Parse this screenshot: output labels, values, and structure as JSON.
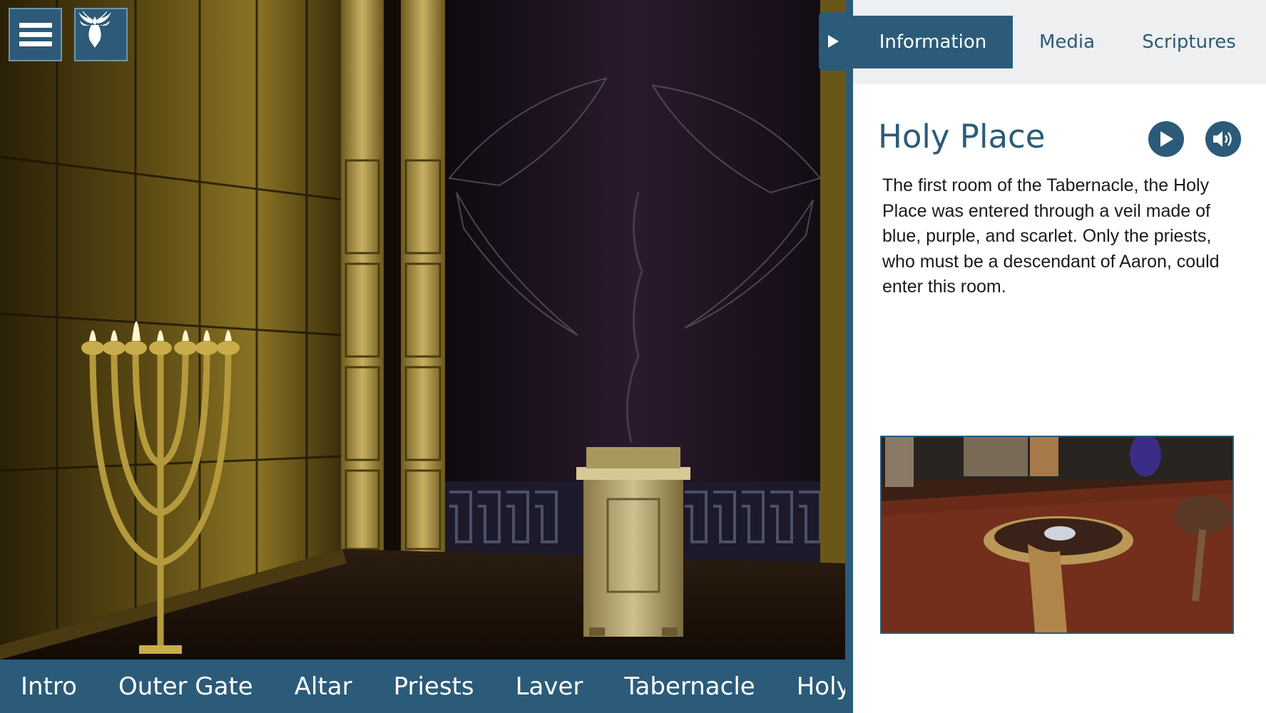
{
  "hud": {
    "menu_icon": "hamburger-menu-icon",
    "logo_icon": "eagle-logo-icon"
  },
  "panel_toggle_icon": "play-triangle-icon",
  "bottom_nav": {
    "items": [
      "Intro",
      "Outer Gate",
      "Altar",
      "Priests",
      "Laver",
      "Tabernacle",
      "Holy"
    ]
  },
  "tabs": {
    "information": "Information",
    "media": "Media",
    "scriptures": "Scriptures"
  },
  "info": {
    "title": "Holy Place",
    "description": "The first room of the Tabernacle, the Holy Place was entered through a veil made of blue, purple, and scarlet. Only the priests, who must be a descendant of Aaron, could enter this room.",
    "play_icon": "play-icon",
    "audio_icon": "speaker-icon",
    "thumbnail_icon": "incense-censer-video-thumbnail"
  },
  "colors": {
    "accent": "#2b5b79",
    "tab_bar_bg": "#eeeff0",
    "gold": "#b49a3c"
  }
}
